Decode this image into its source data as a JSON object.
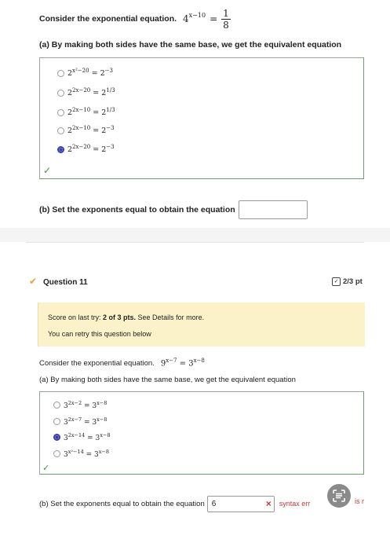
{
  "q1": {
    "prompt": "Consider the exponential equation.",
    "equation_lhs": "4",
    "equation_lhs_exp": "x−10",
    "equation_eq": "=",
    "equation_rhs_num": "1",
    "equation_rhs_den": "8",
    "part_a_label": "(a) By making both sides have the same base, we get the equivalent equation",
    "choices": [
      {
        "base": "2",
        "exp": "x²−20",
        "rhs": "= 2",
        "rhs_exp": "−3",
        "selected": false
      },
      {
        "base": "2",
        "exp": "2x−20",
        "rhs": "= 2",
        "rhs_exp": "1/3",
        "selected": false
      },
      {
        "base": "2",
        "exp": "2x−10",
        "rhs": "= 2",
        "rhs_exp": "1/3",
        "selected": false
      },
      {
        "base": "2",
        "exp": "2x−10",
        "rhs": "= 2",
        "rhs_exp": "−3",
        "selected": false
      },
      {
        "base": "2",
        "exp": "2x−20",
        "rhs": "= 2",
        "rhs_exp": "−3",
        "selected": true
      }
    ],
    "check_mark": "✓",
    "part_b_label": "(b) Set the exponents equal to obtain the equation",
    "part_b_value": ""
  },
  "q11": {
    "title": "Question 11",
    "score_badge": "2/3 pt",
    "notice_line1_prefix": "Score on last try: ",
    "notice_line1_bold": "2 of 3 pts.",
    "notice_line1_suffix": " See Details for more.",
    "notice_line2": "You can retry this question below",
    "prompt": "Consider the exponential equation.",
    "equation_lhs": "9",
    "equation_lhs_exp": "x−7",
    "equation_rhs": "= 3",
    "equation_rhs_exp": "x−8",
    "part_a_label": "(a) By making both sides have the same base, we get the equivalent equation",
    "choices": [
      {
        "base": "3",
        "exp": "2x−2",
        "rhs": "= 3",
        "rhs_exp": "x−8",
        "selected": false
      },
      {
        "base": "3",
        "exp": "2x−7",
        "rhs": "= 3",
        "rhs_exp": "x−8",
        "selected": false
      },
      {
        "base": "3",
        "exp": "2x−14",
        "rhs": "= 3",
        "rhs_exp": "x−8",
        "selected": true
      },
      {
        "base": "3",
        "exp": "x²−14",
        "rhs": "= 3",
        "rhs_exp": "x−8",
        "selected": false
      }
    ],
    "check_mark": "✓",
    "part_b_label": "(b) Set the exponents equal to obtain the equation",
    "part_b_value": "6",
    "error_x": "×",
    "error_text": "syntax err",
    "error_tail": "is r"
  },
  "icons": {
    "question_check": "check-icon",
    "score_icon": "edit-square-icon",
    "floating_button": "text-recognition-icon"
  },
  "colors": {
    "selected_radio": "#3a3fae",
    "correct_green": "#3f8f3f",
    "notice_bg": "#fbf2c9",
    "error_red": "#c23a3a",
    "floating_btn": "#8a8a8a"
  }
}
